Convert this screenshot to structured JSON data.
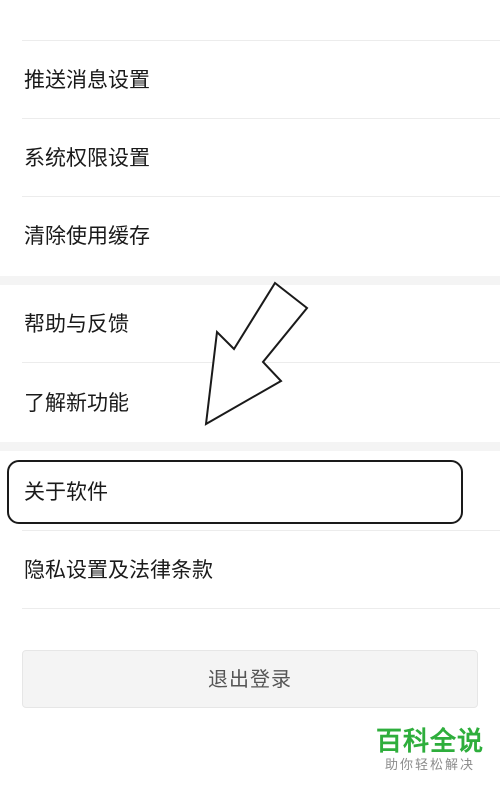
{
  "settings": {
    "items": [
      {
        "label": "推送消息设置"
      },
      {
        "label": "系统权限设置"
      },
      {
        "label": "清除使用缓存"
      },
      {
        "label": "帮助与反馈"
      },
      {
        "label": "了解新功能"
      },
      {
        "label": "关于软件"
      },
      {
        "label": "隐私设置及法律条款"
      }
    ],
    "logout_label": "退出登录"
  },
  "watermark": {
    "title": "百科全说",
    "subtitle": "助你轻松解决"
  },
  "colors": {
    "background": "#ffffff",
    "section_gap": "#f4f4f4",
    "text": "#1a1a1a",
    "divider": "#ececec",
    "watermark_green": "#2eae3c"
  },
  "annotations": {
    "highlighted_item": "关于软件",
    "arrow_icon": "arrow-pointing-down-left-icon"
  }
}
